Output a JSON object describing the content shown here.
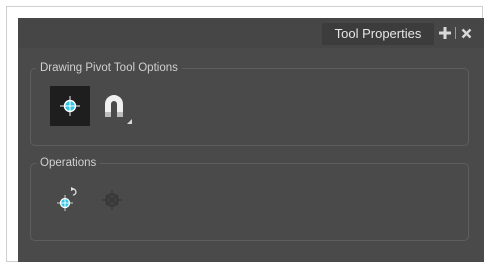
{
  "tab": {
    "title": "Tool Properties",
    "add_icon": "plus-icon",
    "close_icon": "close-icon"
  },
  "drawing_pivot_options": {
    "title": "Drawing Pivot Tool Options",
    "buttons": [
      {
        "name": "pivot-mode-icon",
        "selected": true
      },
      {
        "name": "magnet-icon",
        "selected": false,
        "has_dropdown": true
      }
    ]
  },
  "operations": {
    "title": "Operations",
    "buttons": [
      {
        "name": "reset-pivot-icon",
        "enabled": true
      },
      {
        "name": "convert-pivot-icon",
        "enabled": false
      }
    ]
  },
  "colors": {
    "panel_bg": "#4a4a4a",
    "accent_cyan": "#2fc6e6",
    "text": "#e6e6e6"
  }
}
